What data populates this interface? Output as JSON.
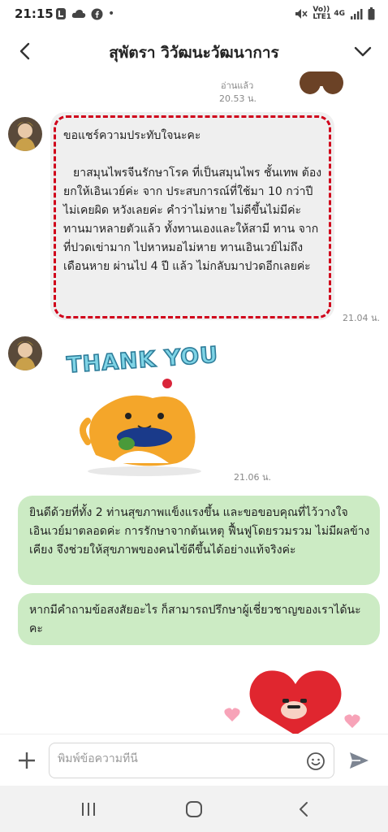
{
  "status_bar": {
    "time": "21:15",
    "dot": "•",
    "volte": "Vo)) LTE1",
    "network": "4G"
  },
  "header": {
    "title": "สุพัตรา วิวัฒนะวัฒนาการ"
  },
  "chat": {
    "read_label": "อ่านแล้ว",
    "top_time": "20.53 น.",
    "messages": [
      {
        "text_head": "ขอแชร์ความประทับใจนะคะ",
        "text_body": "ยาสมุนไพรจีนรักษาโรค ที่เป็นสมุนไพร ชั้นเทพ ต้องยกให้เอินเวย์ค่ะ จาก ประสบการณ์ที่ใช้มา 10 กว่าปี ไม่เคยผิด หวังเลยค่ะ คำว่าไม่หาย ไม่ดีขึ้นไม่มีค่ะ ทานมาหลายตัวแล้ว ทั้งทานเองและให้สามี ทาน จากที่ปวดเข่ามาก ไปหาหมอไม่หาย ทานเอินเวย์ไม่ถึงเดือนหาย ผ่านไป 4 ปี แล้ว ไม่กลับมาปวดอีกเลยค่ะ",
        "time": "21.04 น."
      },
      {
        "sticker_text": "THANK YOU",
        "time": "21.06 น."
      },
      {
        "text": "ยินดีด้วยที่ทั้ง 2 ท่านสุขภาพแข็งแรงขึ้น และขอขอบคุณที่ไว้วางใจเอินเวย์มาตลอดค่ะ การรักษาจากต้นเหตุ ฟื้นฟูโดยรวมรวม ไม่มีผลข้างเคียง จึงช่วยให้สุขภาพของคนไข้ดีขึ้นได้อย่างแท้จริงค่ะ"
      },
      {
        "text": "หากมีคำถามข้อสงสัยอะไร ก็สามารถปรึกษาผู้เชี่ยวชาญของเราได้นะคะ"
      }
    ]
  },
  "composer": {
    "placeholder": "พิมพ์ข้อความที่นี่"
  },
  "colors": {
    "incoming_bubble": "#efefef",
    "outgoing_bubble": "#ccebc4",
    "highlight_border": "#d0001a"
  },
  "icons": {
    "back": "chevron-left-icon",
    "dropdown": "chevron-down-icon",
    "plus": "plus-icon",
    "emoji": "smiley-icon",
    "send": "send-icon"
  }
}
